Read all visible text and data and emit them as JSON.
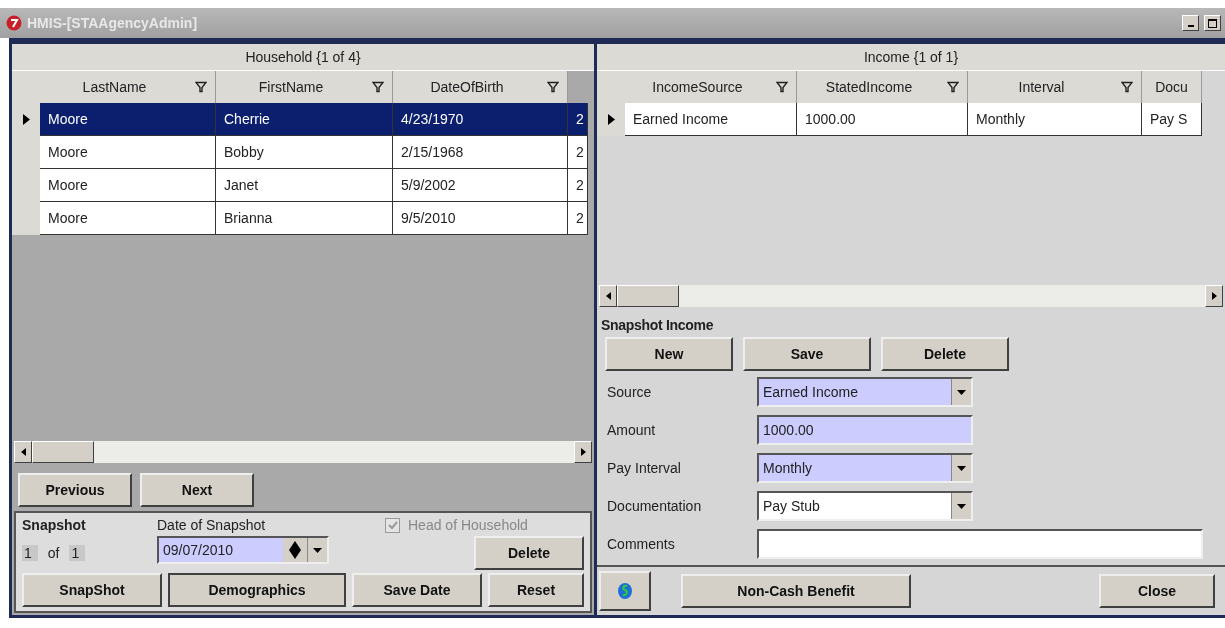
{
  "window": {
    "title": "HMIS-[STAAgencyAdmin]"
  },
  "household": {
    "title": "Household {1 of 4}",
    "columns": [
      {
        "label": "LastName",
        "filter": true
      },
      {
        "label": "FirstName",
        "filter": true
      },
      {
        "label": "DateOfBirth",
        "filter": true
      }
    ],
    "rows": [
      {
        "current": true,
        "selected": true,
        "cells": [
          "Moore",
          "Cherrie",
          "4/23/1970",
          "2"
        ]
      },
      {
        "current": false,
        "selected": false,
        "cells": [
          "Moore",
          "Bobby",
          "2/15/1968",
          "2"
        ]
      },
      {
        "current": false,
        "selected": false,
        "cells": [
          "Moore",
          "Janet",
          "5/9/2002",
          "2"
        ]
      },
      {
        "current": false,
        "selected": false,
        "cells": [
          "Moore",
          "Brianna",
          "9/5/2010",
          "2"
        ]
      }
    ],
    "nav_buttons": [
      "Previous",
      "Next"
    ],
    "snapshot": {
      "heading": "Snapshot",
      "index": "1",
      "of": "of",
      "total": "1",
      "date_label": "Date of Snapshot",
      "date_value": "09/07/2010",
      "head_of_household": {
        "label": "Head of Household",
        "checked": true,
        "disabled": true
      },
      "delete_button": "Delete",
      "buttons": [
        "SnapShot",
        "Demographics",
        "Save Date",
        "Reset"
      ]
    }
  },
  "income": {
    "title": "Income {1 of 1}",
    "columns": [
      {
        "label": "IncomeSource",
        "filter": true
      },
      {
        "label": "StatedIncome",
        "filter": true
      },
      {
        "label": "Interval",
        "filter": true
      },
      {
        "label": "Docu",
        "filter": false
      }
    ],
    "rows": [
      {
        "current": true,
        "selected": false,
        "cells": [
          "Earned Income",
          "1000.00",
          "Monthly",
          "Pay S"
        ]
      }
    ],
    "section_title": "Snapshot Income",
    "buttons": [
      "New",
      "Save",
      "Delete"
    ],
    "fields": [
      {
        "label": "Source",
        "kind": "dropdown",
        "value": "Earned Income",
        "highlighted": true
      },
      {
        "label": "Amount",
        "kind": "text",
        "value": "1000.00",
        "highlighted": true
      },
      {
        "label": "Pay Interval",
        "kind": "dropdown",
        "value": "Monthly",
        "highlighted": true
      },
      {
        "label": "Documentation",
        "kind": "dropdown",
        "value": "Pay Stub",
        "highlighted": false
      },
      {
        "label": "Comments",
        "kind": "wide-text",
        "highlighted": false
      }
    ],
    "footer_buttons": [
      "Non-Cash Benefit",
      "Close"
    ]
  }
}
